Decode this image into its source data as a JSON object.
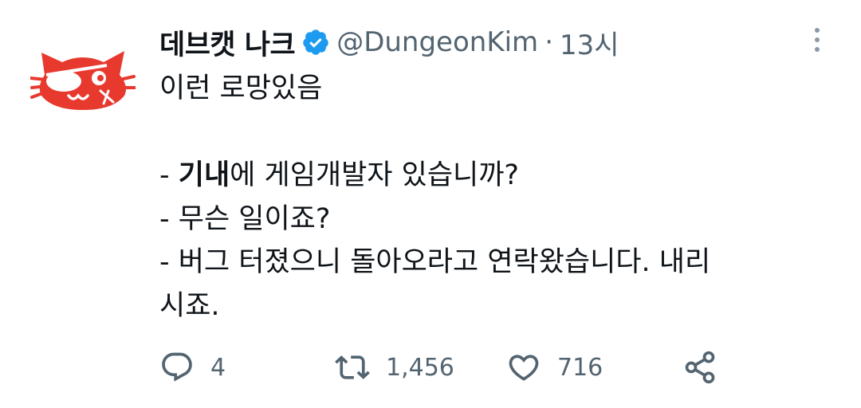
{
  "tweet": {
    "display_name": "데브캣 나크",
    "handle": "@DungeonKim",
    "separator": "·",
    "time": "13시",
    "verified_icon": "verified-badge-icon",
    "more_icon": "more-vertical-icon",
    "body": {
      "line1": "이런 로망있음",
      "line3_dash": "- ",
      "line3_bold": "기내",
      "line3_rest": "에 게임개발자 있습니까?",
      "line4": "- 무슨 일이죠?",
      "line5": "- 버그 터졌으니 돌아오라고 연락왔습니다. 내리",
      "line6": "시죠."
    },
    "actions": {
      "reply_count": "4",
      "retweet_count": "1,456",
      "like_count": "716"
    }
  },
  "colors": {
    "text": "#0f1419",
    "secondary": "#536471",
    "verified": "#1d9bf0",
    "avatar_red": "#e8392e"
  }
}
